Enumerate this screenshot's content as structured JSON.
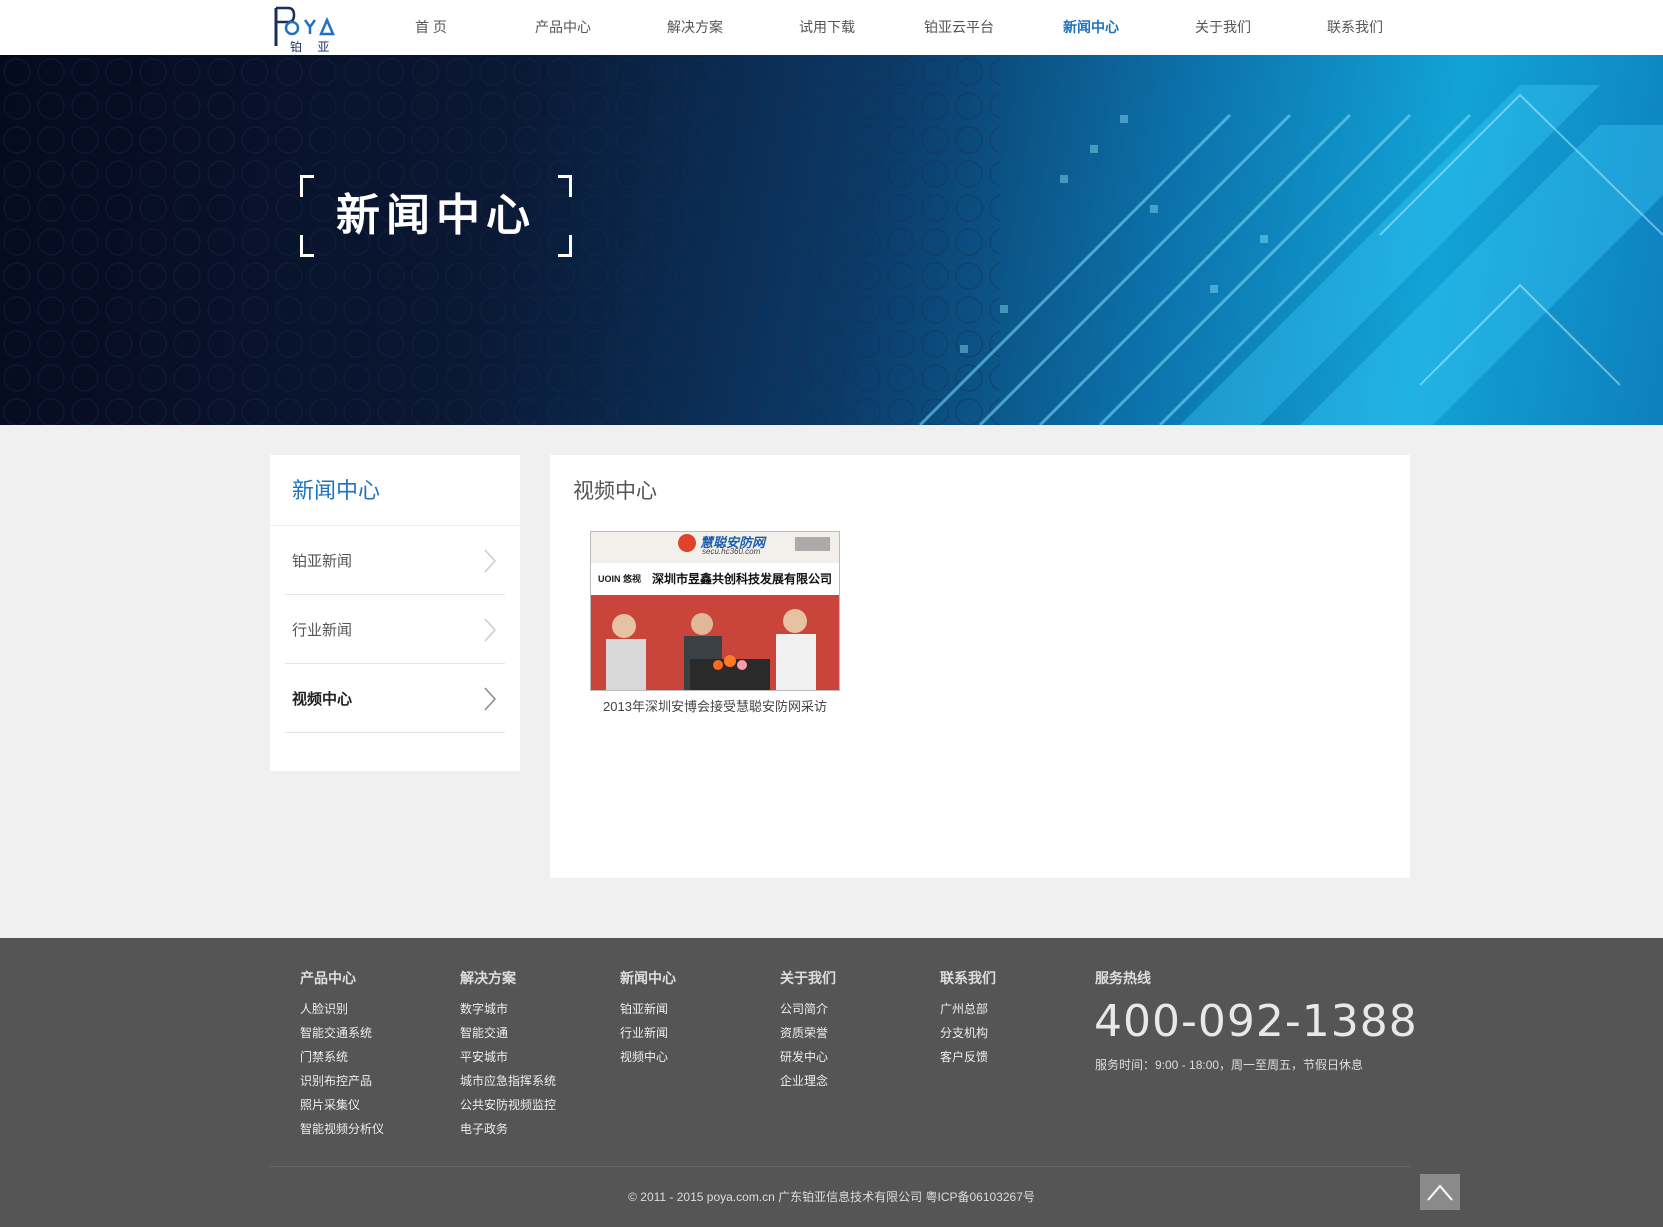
{
  "logo": {
    "text": "铂 亚",
    "mark": "POYA"
  },
  "nav": {
    "items": [
      "首 页",
      "产品中心",
      "解决方案",
      "试用下载",
      "铂亚云平台",
      "新闻中心",
      "关于我们",
      "联系我们"
    ],
    "active_index": 5
  },
  "banner": {
    "title": "新闻中心"
  },
  "sidebar": {
    "title": "新闻中心",
    "items": [
      {
        "label": "铂亚新闻"
      },
      {
        "label": "行业新闻"
      },
      {
        "label": "视频中心"
      }
    ],
    "active_index": 2
  },
  "main": {
    "title": "视频中心",
    "videos": [
      {
        "caption": "2013年深圳安博会接受慧聪安防网采访",
        "thumb_site_name": "慧聪安防网",
        "thumb_site_url": "secu.hc360.com",
        "thumb_brand": "UOIN 悠视",
        "thumb_company": "深圳市昱鑫共创科技发展有限公司"
      }
    ]
  },
  "footer": {
    "columns": [
      {
        "title": "产品中心",
        "links": [
          "人脸识别",
          "智能交通系统",
          "门禁系统",
          "识别布控产品",
          "照片采集仪",
          "智能视频分析仪"
        ]
      },
      {
        "title": "解决方案",
        "links": [
          "数字城市",
          "智能交通",
          "平安城市",
          "城市应急指挥系统",
          "公共安防视频监控",
          "电子政务"
        ]
      },
      {
        "title": "新闻中心",
        "links": [
          "铂亚新闻",
          "行业新闻",
          "视频中心"
        ]
      },
      {
        "title": "关于我们",
        "links": [
          "公司简介",
          "资质荣誉",
          "研发中心",
          "企业理念"
        ]
      },
      {
        "title": "联系我们",
        "links": [
          "广州总部",
          "分支机构",
          "客户反馈"
        ]
      }
    ],
    "hotline_title": "服务热线",
    "hotline": "400-092-1388",
    "hours": "服务时间：9:00 - 18:00，周一至周五，节假日休息",
    "copyright": "© 2011 - 2015 poya.com.cn 广东铂亚信息技术有限公司 粤ICP备06103267号"
  },
  "colors": {
    "accent": "#1e73be",
    "footer_bg": "#555555",
    "page_bg": "#f0f0f0"
  }
}
